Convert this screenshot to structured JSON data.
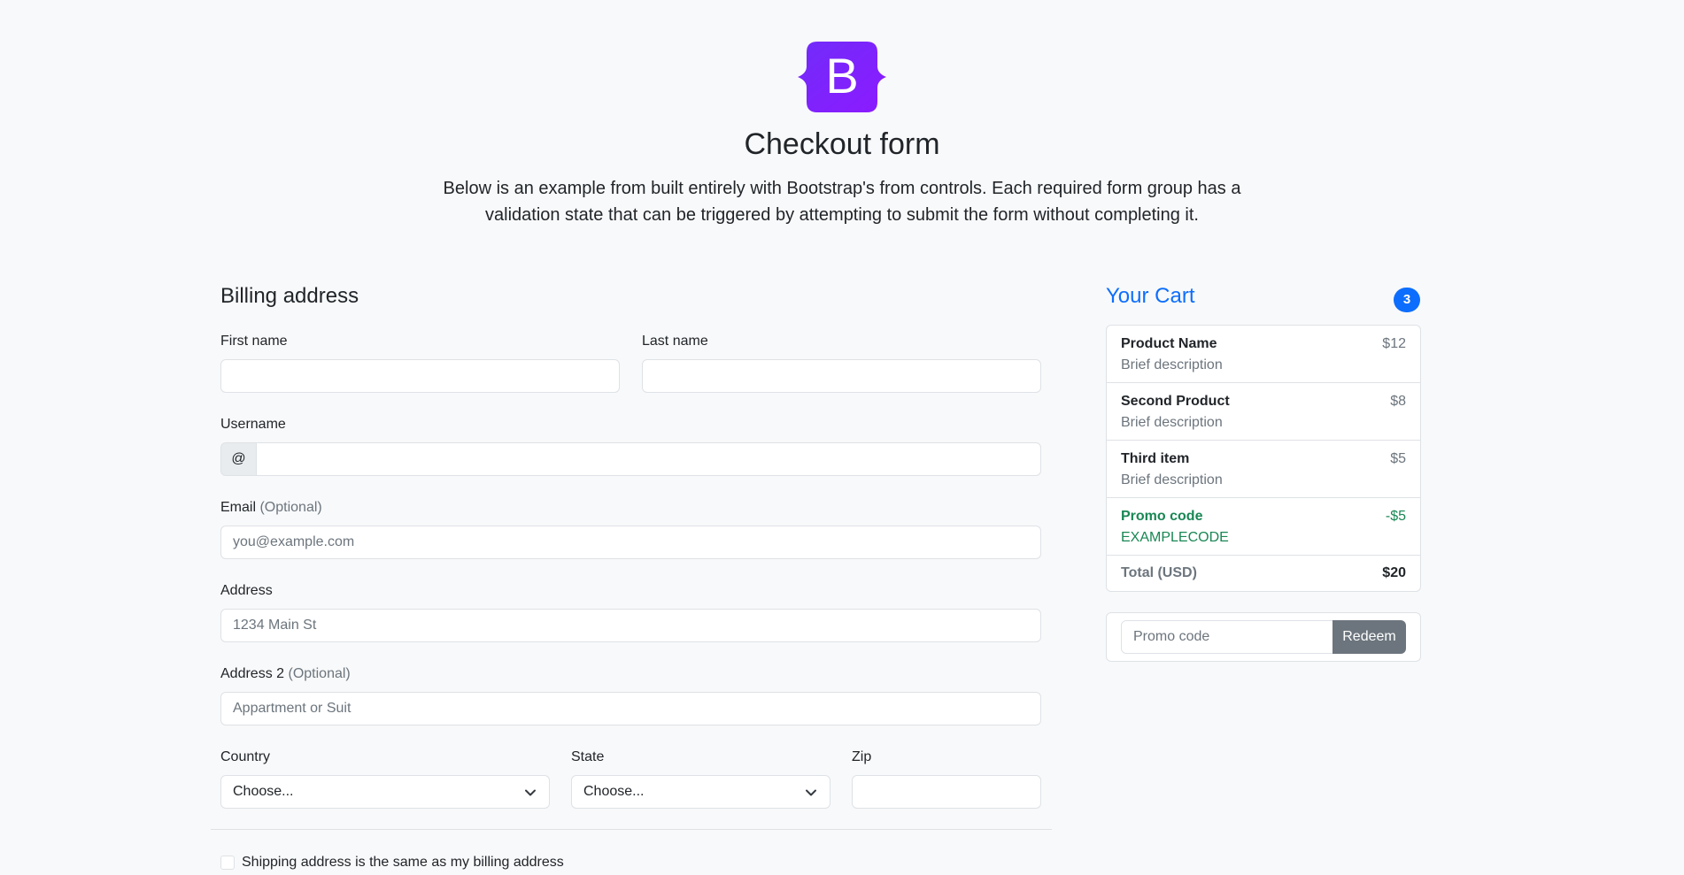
{
  "header": {
    "logo_letter": "B",
    "title": "Checkout form",
    "lead": "Below is an example from built entirely with Bootstrap's from controls. Each required form group has a validation state that can be triggered by attempting to submit the form without completing it.",
    "logo_color_start": "#712cf9",
    "logo_color_end": "#8c1aff"
  },
  "billing": {
    "title": "Billing address",
    "first_name_label": "First name",
    "first_name_value": "",
    "last_name_label": "Last name",
    "last_name_value": "",
    "username_label": "Username",
    "username_prefix": "@",
    "username_value": "",
    "email_label": "Email",
    "email_optional": "(Optional)",
    "email_placeholder": "you@example.com",
    "address_label": "Address",
    "address_placeholder": "1234 Main St",
    "address2_label": "Address 2",
    "address2_optional": "(Optional)",
    "address2_placeholder": "Appartment or Suit",
    "country_label": "Country",
    "country_selected": "Choose...",
    "state_label": "State",
    "state_selected": "Choose...",
    "zip_label": "Zip",
    "zip_value": "",
    "same_address_label": "Shipping address is the same as my billing address",
    "same_address_checked": false
  },
  "cart": {
    "title": "Your Cart",
    "count": "3",
    "accent_color": "#0d6efd",
    "items": [
      {
        "name": "Product Name",
        "desc": "Brief description",
        "price": "$12"
      },
      {
        "name": "Second Product",
        "desc": "Brief description",
        "price": "$8"
      },
      {
        "name": "Third item",
        "desc": "Brief description",
        "price": "$5"
      }
    ],
    "promo": {
      "name": "Promo code",
      "code": "EXAMPLECODE",
      "discount": "-$5",
      "color": "#198754"
    },
    "total_label": "Total (USD)",
    "total_value": "$20",
    "promo_input_placeholder": "Promo code",
    "redeem_label": "Redeem"
  }
}
